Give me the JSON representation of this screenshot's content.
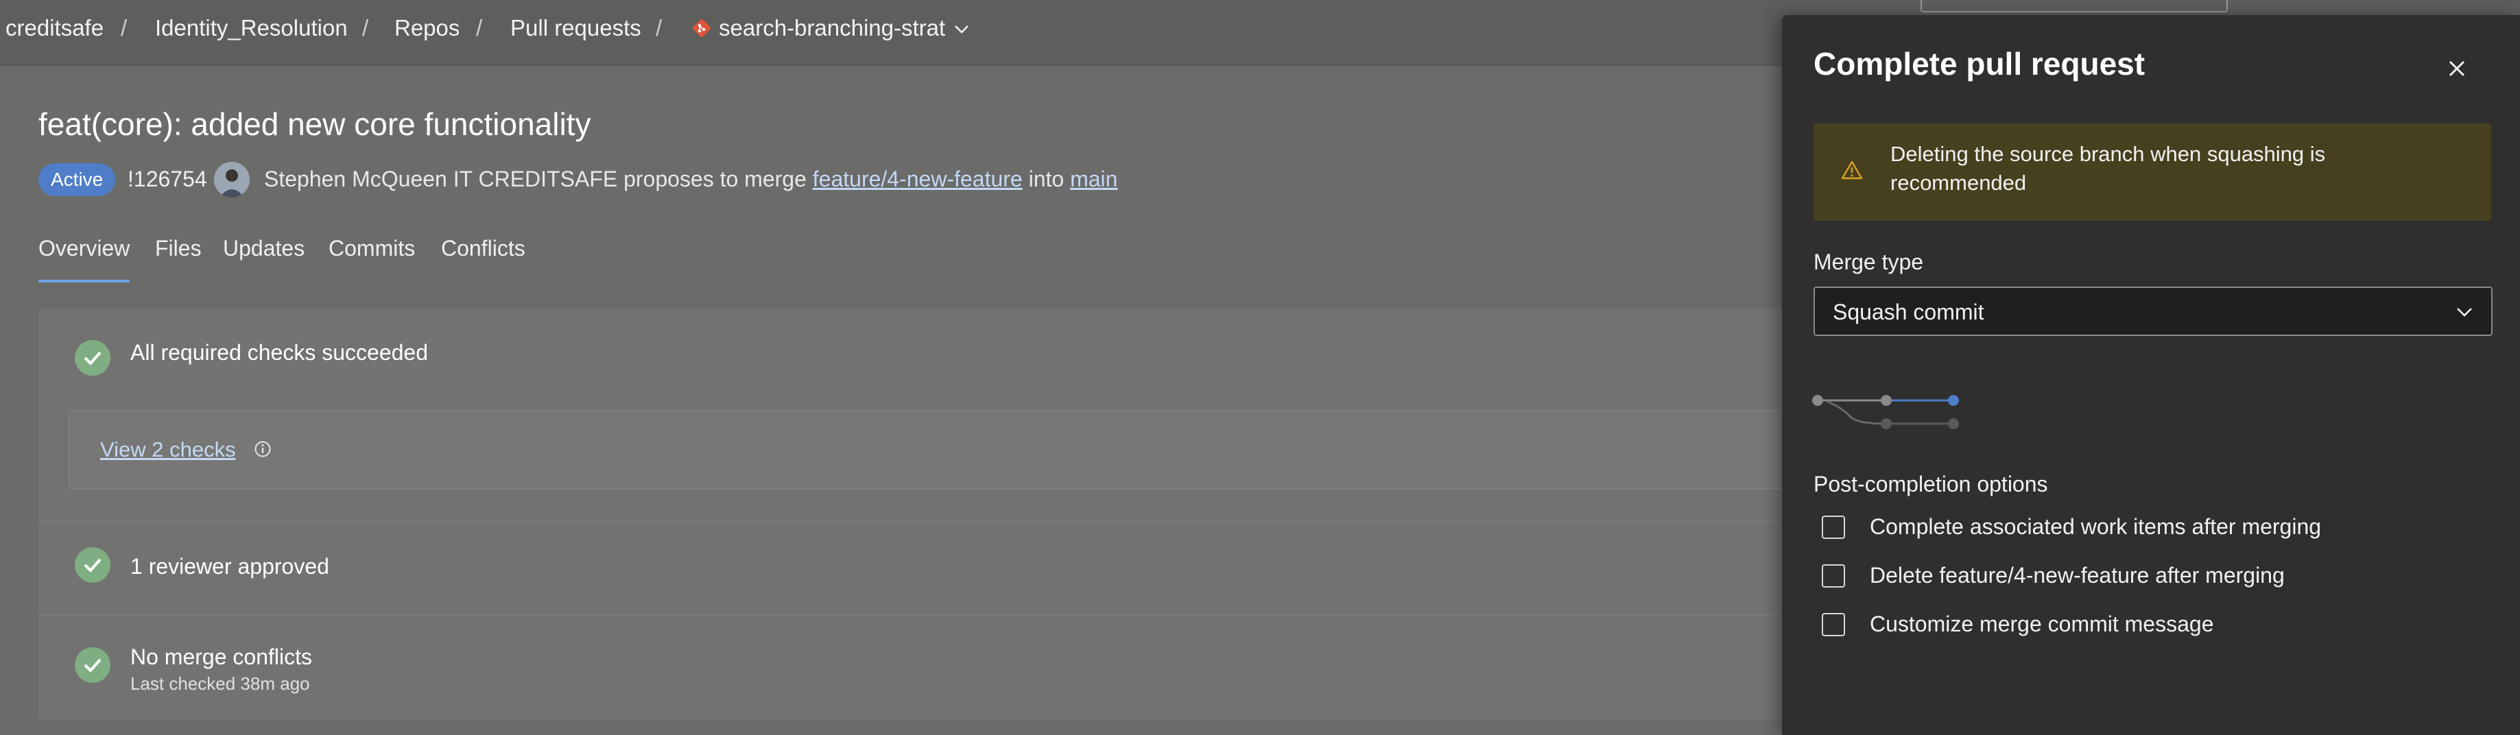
{
  "breadcrumb": {
    "items": [
      "creditsafe",
      "Identity_Resolution",
      "Repos",
      "Pull requests",
      "search-branching-strat"
    ],
    "separator": "/"
  },
  "pull_request": {
    "title": "feat(core): added new core functionality",
    "status": "Active",
    "id": "!126754",
    "author": "Stephen McQueen IT CREDITSAFE",
    "proposes_text": "proposes to merge",
    "source_branch": "feature/4-new-feature",
    "into_text": "into",
    "target_branch": "main"
  },
  "tabs": [
    "Overview",
    "Files",
    "Updates",
    "Commits",
    "Conflicts"
  ],
  "checks": {
    "required": "All required checks succeeded",
    "view_checks": "View 2 checks",
    "reviewers": "1 reviewer approved",
    "conflicts": "No merge conflicts",
    "conflicts_sub": "Last checked 38m ago"
  },
  "panel": {
    "title": "Complete pull request",
    "warning": "Deleting the source branch when squashing is recommended",
    "merge_type_label": "Merge type",
    "merge_type_value": "Squash commit",
    "post_completion_label": "Post-completion options",
    "options": [
      {
        "label": "Complete associated work items after merging",
        "checked": false
      },
      {
        "label": "Delete feature/4-new-feature after merging",
        "checked": false
      },
      {
        "label": "Customize merge commit message",
        "checked": false
      }
    ]
  },
  "colors": {
    "accent": "#4f7dc7",
    "success": "#7fae82",
    "warning_bg": "#47401f",
    "warning_icon": "#d6a21e",
    "link": "#c2d8f5",
    "panel_bg": "#2f2f2f"
  },
  "icons": [
    "git-branch-icon",
    "chevron-down-icon",
    "checkmark-icon",
    "info-icon",
    "close-icon",
    "warning-icon",
    "merge-graph-icon"
  ]
}
